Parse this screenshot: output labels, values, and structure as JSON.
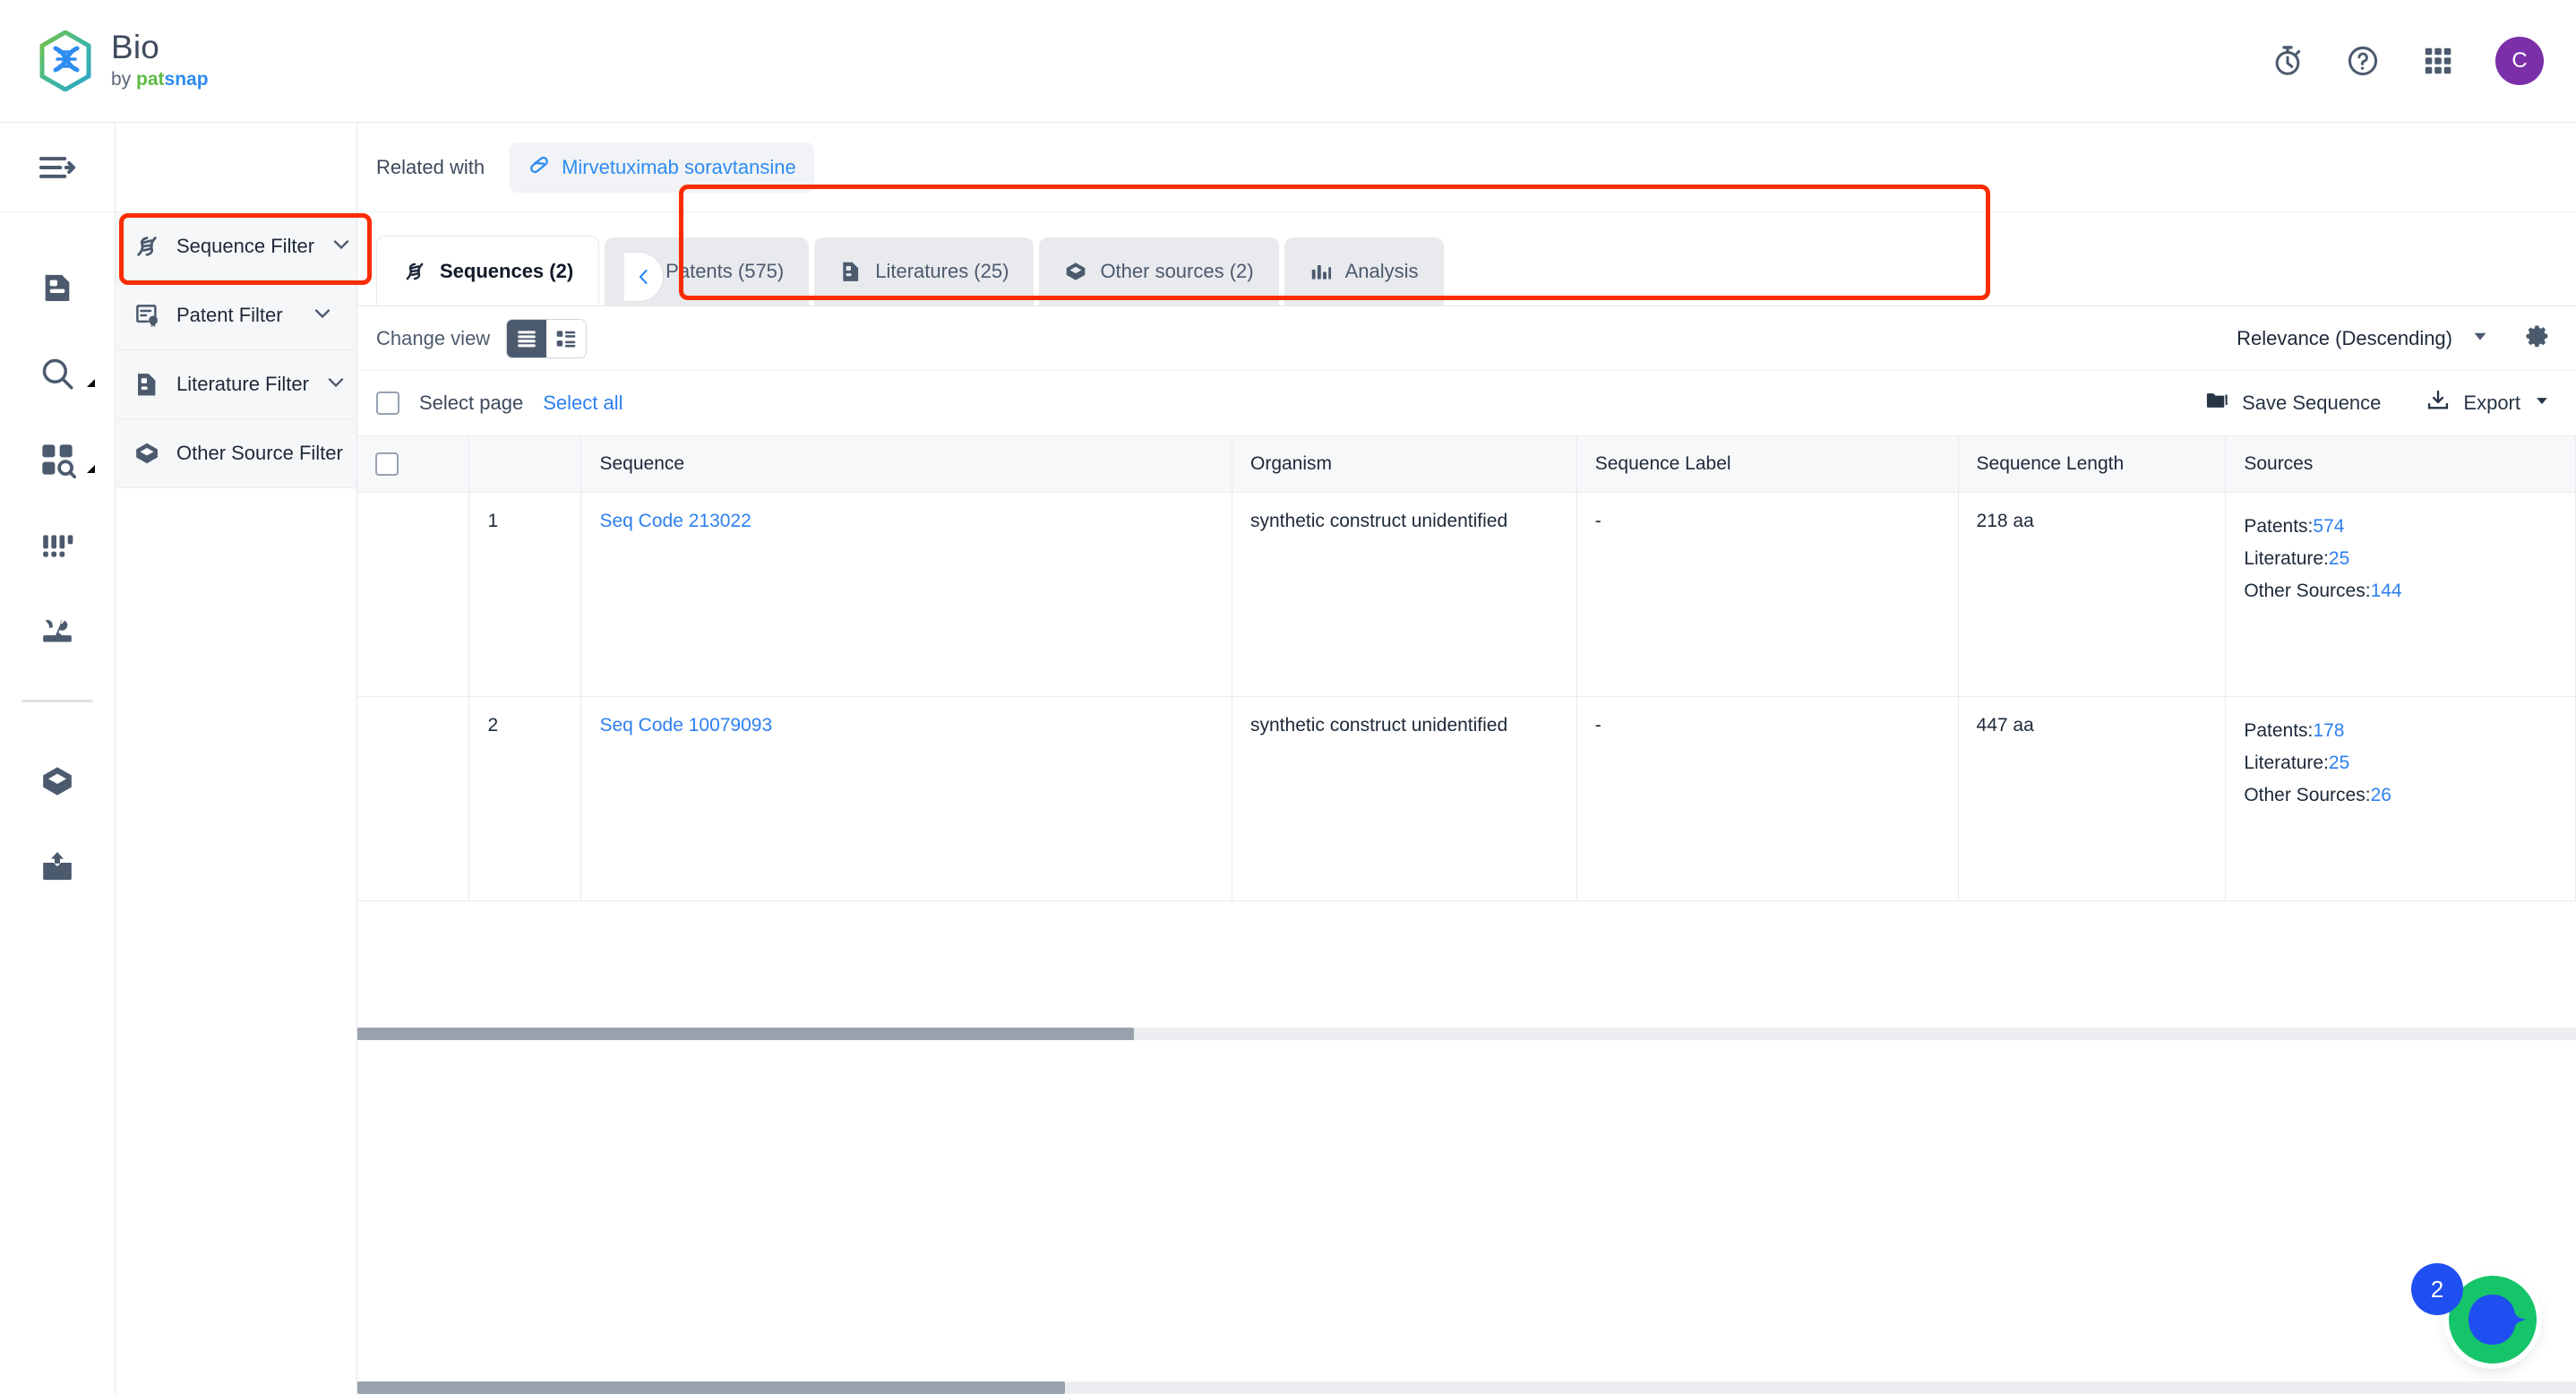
{
  "header": {
    "brand_title": "Bio",
    "brand_by": "by ",
    "brand_pat": "pat",
    "brand_snap": "snap",
    "icons": [
      "stopwatch-icon",
      "help-icon",
      "apps-grid-icon"
    ],
    "avatar_initial": "C"
  },
  "rail": {
    "toggle": "menu-expand-icon",
    "items": [
      {
        "icon": "document-icon",
        "name": "documents"
      },
      {
        "icon": "search-icon",
        "name": "search",
        "caret": true
      },
      {
        "icon": "grid-search-icon",
        "name": "grid-search",
        "caret": true
      },
      {
        "icon": "columns-icon",
        "name": "datasets"
      },
      {
        "icon": "tools-icon",
        "name": "tools"
      },
      {
        "icon": "cube-icon",
        "name": "other-sources"
      },
      {
        "icon": "upload-inbox-icon",
        "name": "upload"
      }
    ]
  },
  "filters": {
    "items": [
      {
        "label": "Sequence Filter",
        "icon": "dna-icon"
      },
      {
        "label": "Patent Filter",
        "icon": "patent-certificate-icon"
      },
      {
        "label": "Literature Filter",
        "icon": "document-icon"
      },
      {
        "label": "Other Source Filter",
        "icon": "cube-icon"
      }
    ]
  },
  "related": {
    "label": "Related with",
    "chip": "Mirvetuximab soravtansine",
    "chip_icon": "capsule-icon"
  },
  "tabs": [
    {
      "label": "Sequences (2)",
      "icon": "dna-icon",
      "active": true
    },
    {
      "label": "Patents (575)",
      "icon": "patent-certificate-icon",
      "active": false
    },
    {
      "label": "Literatures (25)",
      "icon": "document-icon",
      "active": false
    },
    {
      "label": "Other sources (2)",
      "icon": "cube-icon",
      "active": false
    },
    {
      "label": "Analysis",
      "icon": "bar-chart-icon",
      "active": false
    }
  ],
  "viewbar": {
    "change_view_label": "Change view",
    "list_view_icon": "list-view-icon",
    "detail_view_icon": "detail-view-icon",
    "sort_value": "Relevance (Descending)",
    "settings_icon": "gear-icon"
  },
  "selectbar": {
    "select_page": "Select page",
    "select_all": "Select all",
    "save_sequence": "Save Sequence",
    "save_icon": "folder-icon",
    "export": "Export",
    "export_icon": "download-icon"
  },
  "table": {
    "columns": [
      "Sequence",
      "Organism",
      "Sequence Label",
      "Sequence Length",
      "Sources"
    ],
    "source_labels": {
      "patents": "Patents:",
      "literature": "Literature:",
      "other": "Other Sources:"
    },
    "rows": [
      {
        "num": "1",
        "sequence": "Seq Code 213022",
        "organism": "synthetic construct unidentified",
        "label": "-",
        "length": "218 aa",
        "patents": "574",
        "literature": "25",
        "other_sources": "144"
      },
      {
        "num": "2",
        "sequence": "Seq Code 10079093",
        "organism": "synthetic construct unidentified",
        "label": "-",
        "length": "447 aa",
        "patents": "178",
        "literature": "25",
        "other_sources": "26"
      }
    ]
  },
  "chat": {
    "badge": "2"
  },
  "colors": {
    "accent_blue": "#2d7ff0",
    "annotation_red": "#fb2c02",
    "avatar_purple": "#7b2fa8",
    "chat_green": "#16c46a"
  }
}
